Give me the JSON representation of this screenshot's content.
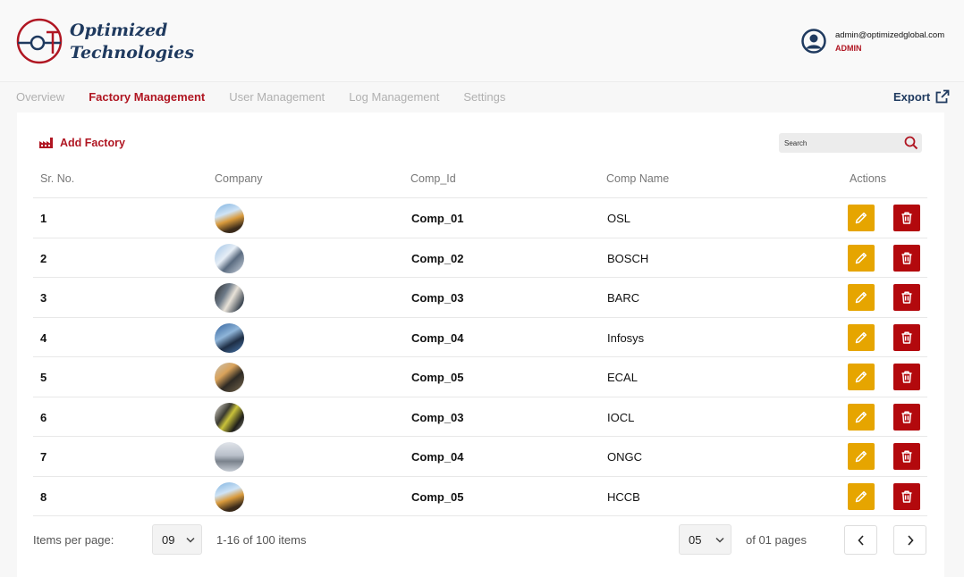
{
  "brand": {
    "line1": "Optimized",
    "line2": "Technologies"
  },
  "user": {
    "email": "admin@optimizedglobal.com",
    "role": "ADMIN"
  },
  "tabs": [
    {
      "label": "Overview",
      "active": false
    },
    {
      "label": "Factory Management",
      "active": true
    },
    {
      "label": "User Management",
      "active": false
    },
    {
      "label": "Log Management",
      "active": false
    },
    {
      "label": "Settings",
      "active": false
    }
  ],
  "export_label": "Export",
  "add_factory_label": "Add Factory",
  "search": {
    "placeholder": "Search"
  },
  "table": {
    "headers": {
      "sr": "Sr. No.",
      "company": "Company",
      "comp_id": "Comp_Id",
      "comp_name": "Comp Name",
      "actions": "Actions"
    },
    "rows": [
      {
        "sr": "1",
        "comp_id": "Comp_01",
        "comp_name": "OSL"
      },
      {
        "sr": "2",
        "comp_id": "Comp_02",
        "comp_name": "BOSCH"
      },
      {
        "sr": "3",
        "comp_id": "Comp_03",
        "comp_name": "BARC"
      },
      {
        "sr": "4",
        "comp_id": "Comp_04",
        "comp_name": "Infosys"
      },
      {
        "sr": "5",
        "comp_id": "Comp_05",
        "comp_name": "ECAL"
      },
      {
        "sr": "6",
        "comp_id": "Comp_03",
        "comp_name": "IOCL"
      },
      {
        "sr": "7",
        "comp_id": "Comp_04",
        "comp_name": "ONGC"
      },
      {
        "sr": "8",
        "comp_id": "Comp_05",
        "comp_name": "HCCB"
      }
    ]
  },
  "pagination": {
    "items_per_page_label": "Items per page:",
    "items_per_page_value": "09",
    "range_text": "1-16 of 100 items",
    "page_value": "05",
    "pages_text": "of 01 pages"
  },
  "colors": {
    "accent": "#b01622",
    "navy": "#1f3a5f",
    "edit": "#e6a500",
    "delete": "#b3090d"
  }
}
